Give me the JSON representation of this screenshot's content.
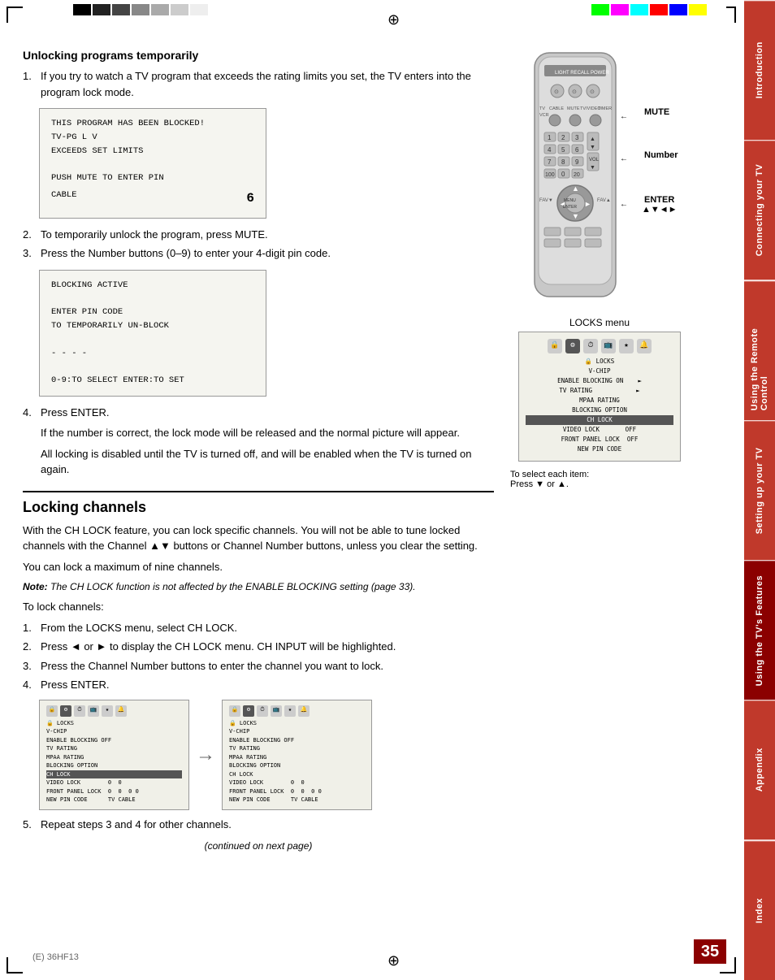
{
  "page": {
    "number": "35",
    "footer": "(E) 36HF13",
    "crosshair": "⊕",
    "continued": "(continued on next page)"
  },
  "sidebar": {
    "tabs": [
      {
        "label": "Introduction",
        "active": false
      },
      {
        "label": "Connecting your TV",
        "active": false
      },
      {
        "label": "Using the Remote Control",
        "active": false
      },
      {
        "label": "Setting up your TV",
        "active": false
      },
      {
        "label": "Using the TV's Features",
        "active": true
      },
      {
        "label": "Appendix",
        "active": false
      },
      {
        "label": "Index",
        "active": false
      }
    ]
  },
  "section1": {
    "title": "Unlocking programs temporarily",
    "steps": [
      "If you try to watch a TV program that exceeds the rating limits you set, the TV enters into the program lock mode.",
      "To temporarily unlock the program, press MUTE.",
      "Press the Number buttons (0–9) to enter your 4-digit pin code.",
      "Press ENTER."
    ],
    "step4_detail1": "If the number is correct, the lock mode will be released and the normal picture will appear.",
    "step4_detail2": "All locking is disabled until the TV is turned off, and will be enabled when the TV is turned on again."
  },
  "screen1": {
    "line1": "THIS PROGRAM HAS BEEN BLOCKED!",
    "line2": "TV-PG   L   V",
    "line3": "EXCEEDS SET LIMITS",
    "line4": "",
    "line5": "PUSH MUTE TO ENTER PIN",
    "label": "CABLE",
    "number": "6"
  },
  "screen2": {
    "line1": "BLOCKING ACTIVE",
    "line2": "",
    "line3": "ENTER PIN CODE",
    "line4": "TO TEMPORARILY UN-BLOCK",
    "line5": "",
    "line6": "- - - -",
    "line7": "",
    "line8": "0-9:TO SELECT  ENTER:TO SET"
  },
  "section2": {
    "title": "Locking channels",
    "intro": "With the CH LOCK feature, you can lock specific channels. You will not be able to tune locked channels with the Channel ▲▼ buttons or Channel Number buttons, unless you clear the setting.",
    "max": "You can lock a maximum of nine channels.",
    "note_label": "Note:",
    "note": "The CH LOCK function is not affected by the ENABLE BLOCKING setting (page 33).",
    "to_lock": "To lock channels:",
    "steps": [
      "From the LOCKS menu, select CH LOCK.",
      "Press ◄ or ► to display the CH LOCK menu. CH INPUT will be highlighted.",
      "Press the Channel Number buttons to enter the channel you want to lock.",
      "Press ENTER.",
      "Repeat steps 3 and 4 for other channels."
    ]
  },
  "locks_menu": {
    "title": "LOCKS menu",
    "items": [
      "LOCKS",
      "V-CHIP",
      "ENABLE BLOCKING  ON",
      "TV RATING",
      "MPAA RATING",
      "BLOCKING OPTION",
      "CH LOCK",
      "VIDEO LOCK         OFF",
      "FRONT PANEL LOCK   OFF",
      "NEW PIN CODE"
    ]
  },
  "select_text": {
    "line1": "To select each item:",
    "line2": "Press ▼ or ▲."
  },
  "remote_labels": {
    "mute": "MUTE",
    "number": "Number",
    "enter": "ENTER"
  },
  "ch_lock_box1": {
    "items": [
      "LOCKS",
      "V-CHIP",
      "ENABLE BLOCKING  OFF",
      "TV RATING",
      "MPAA RATING",
      "BLOCKING OPTION",
      "CH LOCK",
      "VIDEO LOCK         0  0",
      "FRONT PANEL LOCK   0  0  0 0",
      "NEW PIN CODE       TV CABLE"
    ]
  },
  "ch_lock_box2": {
    "items": [
      "LOCKS",
      "V-CHIP",
      "ENABLE BLOCKING  OFF",
      "TV RATING",
      "MPAA RATING",
      "BLOCKING OPTION",
      "CH LOCK",
      "VIDEO LOCK         0  0",
      "FRONT PANEL LOCK   0  0  0 0",
      "NEW PIN CODE       TV CABLE"
    ]
  },
  "colors": {
    "sidebar_bg": "#c0392b",
    "sidebar_active": "#8B0000",
    "page_num_bg": "#8B0000"
  }
}
